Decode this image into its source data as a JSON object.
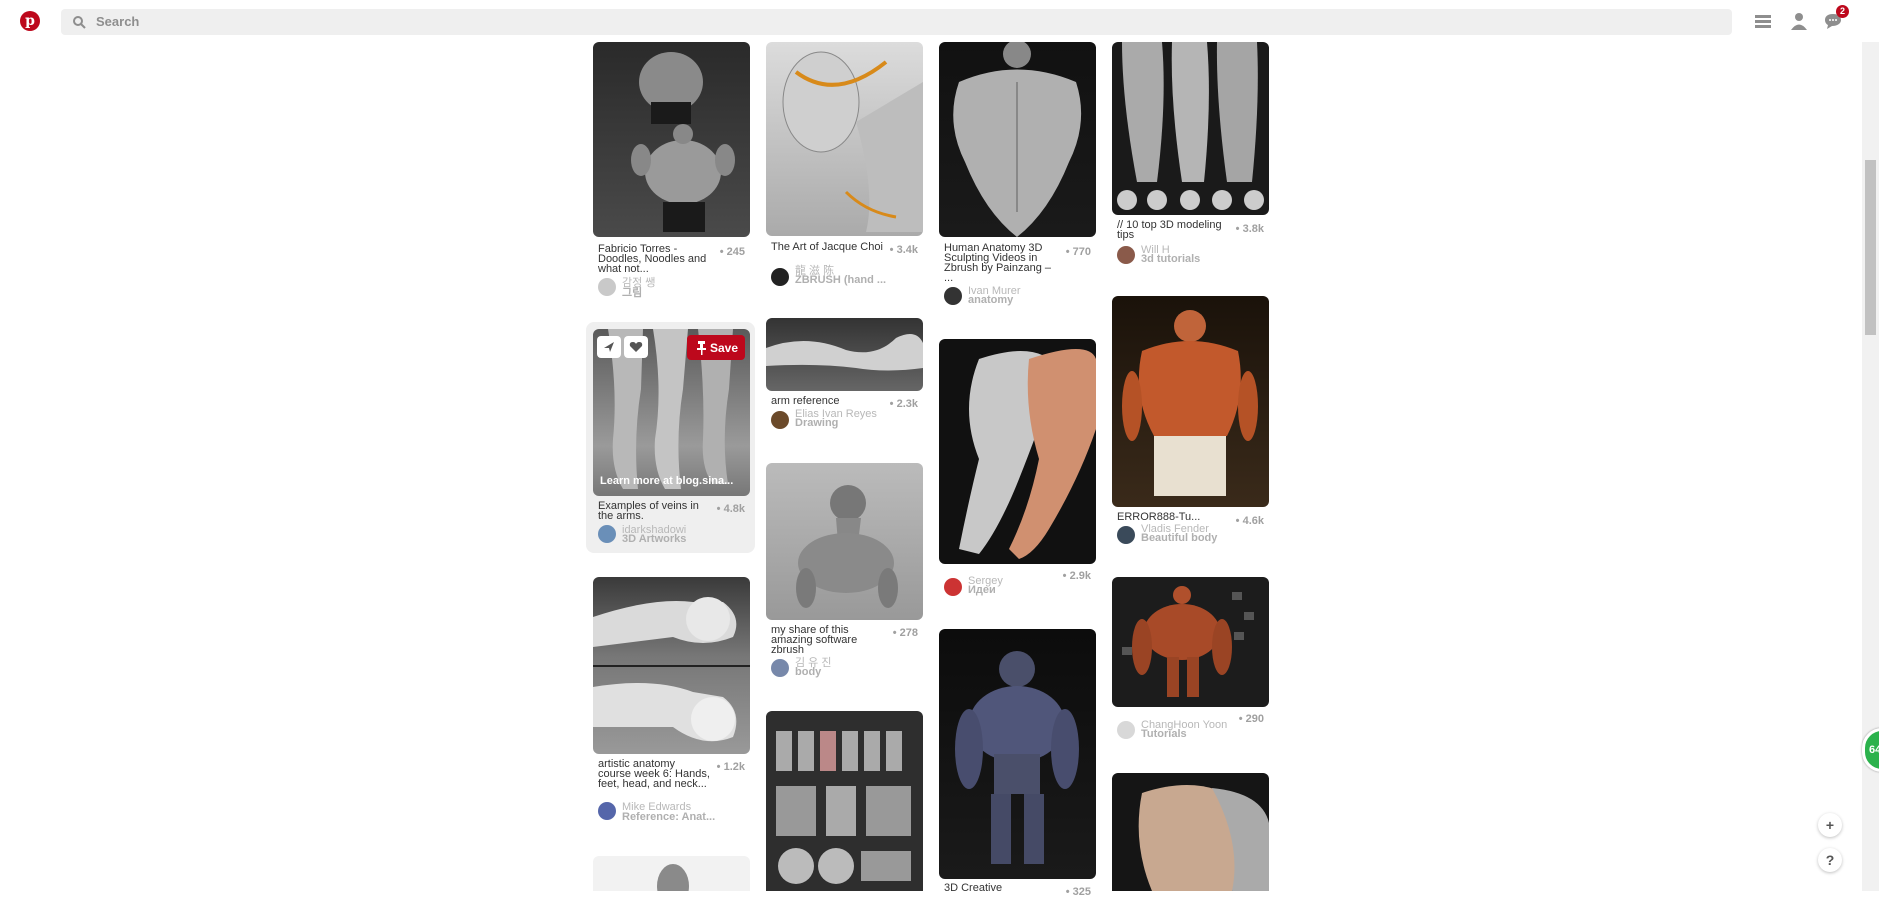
{
  "brand": {
    "logo_letter": "p",
    "color": "#bd081c"
  },
  "search": {
    "placeholder": "Search"
  },
  "header_icons": [
    "menu-icon",
    "user-icon",
    "messages-icon"
  ],
  "notification_count": "2",
  "hover_actions": {
    "save_label": "Save",
    "link_label": "Learn more at blog.sina..."
  },
  "pins": [
    {
      "id": "p1",
      "title": "Fabricio Torres - Doodles, Noodles and what not...",
      "saves": "245",
      "user": "감정 쌩",
      "board": "그림"
    },
    {
      "id": "p2",
      "title": "The Art of Jacque Choi",
      "saves": "3.4k",
      "user": "龍 滋 陈",
      "board": "ZBRUSH (hand ..."
    },
    {
      "id": "p3",
      "title": "Human Anatomy 3D Sculpting Videos in Zbrush by Painzang – ...",
      "saves": "770",
      "user": "Ivan Murer",
      "board": "anatomy"
    },
    {
      "id": "p4",
      "title": "// 10 top 3D modeling tips",
      "saves": "3.8k",
      "user": "Will H",
      "board": "3d tutorials"
    },
    {
      "id": "p5",
      "title": "Examples of veins in the arms.",
      "saves": "4.8k",
      "user": "idarkshadowi",
      "board": "3D Artworks"
    },
    {
      "id": "p6",
      "title": "arm reference",
      "saves": "2.3k",
      "user": "Elias Ivan Reyes",
      "board": "Drawing"
    },
    {
      "id": "p7",
      "title": "",
      "saves": "2.9k",
      "user": "Sergey",
      "board": "Идеи"
    },
    {
      "id": "p8",
      "title": "ERROR888-Tu...",
      "saves": "4.6k",
      "user": "Vladis Fender",
      "board": "Beautiful body"
    },
    {
      "id": "p9",
      "title": "my share of this amazing software zbrush",
      "saves": "278",
      "user": "김 유 진",
      "board": "body"
    },
    {
      "id": "p10",
      "title": "artistic anatomy course week 6: Hands, feet, head, and neck...",
      "saves": "1.2k",
      "user": "Mike Edwards",
      "board": "Reference: Anat..."
    },
    {
      "id": "p11",
      "title": "",
      "saves": "290",
      "user": "ChangHoon Yoon",
      "board": "Tutorials"
    },
    {
      "id": "p12",
      "title": "3D Creative",
      "saves": "325",
      "user": "",
      "board": ""
    },
    {
      "id": "p13",
      "title": "",
      "saves": "",
      "user": "",
      "board": ""
    },
    {
      "id": "p14",
      "title": "",
      "saves": "",
      "user": "",
      "board": ""
    },
    {
      "id": "p15",
      "title": "",
      "saves": "",
      "user": "",
      "board": ""
    }
  ],
  "floating": {
    "add": "+",
    "help": "?",
    "green_badge": "64"
  }
}
